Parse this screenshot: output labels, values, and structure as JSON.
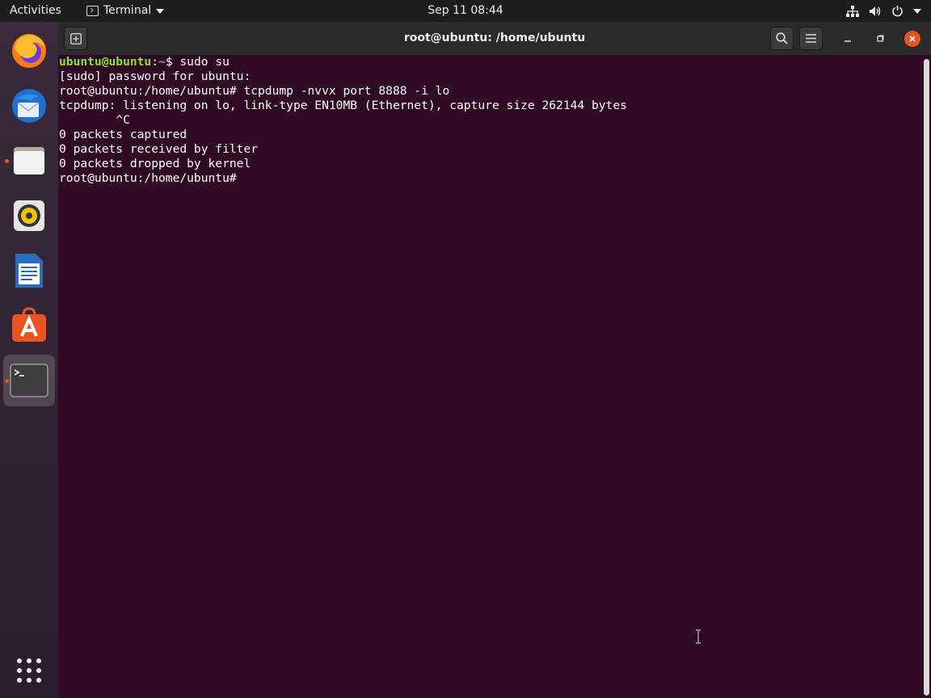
{
  "topbar": {
    "activities": "Activities",
    "app_name": "Terminal",
    "clock": "Sep 11  08:44"
  },
  "dock": {
    "items": [
      {
        "name": "firefox",
        "running": false
      },
      {
        "name": "thunderbird",
        "running": false
      },
      {
        "name": "files",
        "running": true
      },
      {
        "name": "rhythmbox",
        "running": false
      },
      {
        "name": "libreoffice-writer",
        "running": false
      },
      {
        "name": "ubuntu-software",
        "running": false
      },
      {
        "name": "terminal",
        "running": true,
        "active": true
      }
    ]
  },
  "window": {
    "title": "root@ubuntu: /home/ubuntu"
  },
  "terminal": {
    "prompt_user": "ubuntu@ubuntu",
    "prompt_sep": ":",
    "prompt_path": "~",
    "prompt_end": "$ sudo su",
    "lines": [
      "[sudo] password for ubuntu:",
      "root@ubuntu:/home/ubuntu# tcpdump -nvvx port 8888 -i lo",
      "tcpdump: listening on lo, link-type EN10MB (Ethernet), capture size 262144 bytes",
      "        ^C",
      "0 packets captured",
      "0 packets received by filter",
      "0 packets dropped by kernel",
      "root@ubuntu:/home/ubuntu# "
    ]
  },
  "colors": {
    "terminal_bg": "#300a24",
    "accent": "#e95420",
    "prompt_user": "#8ae234",
    "prompt_path": "#729fcf"
  }
}
